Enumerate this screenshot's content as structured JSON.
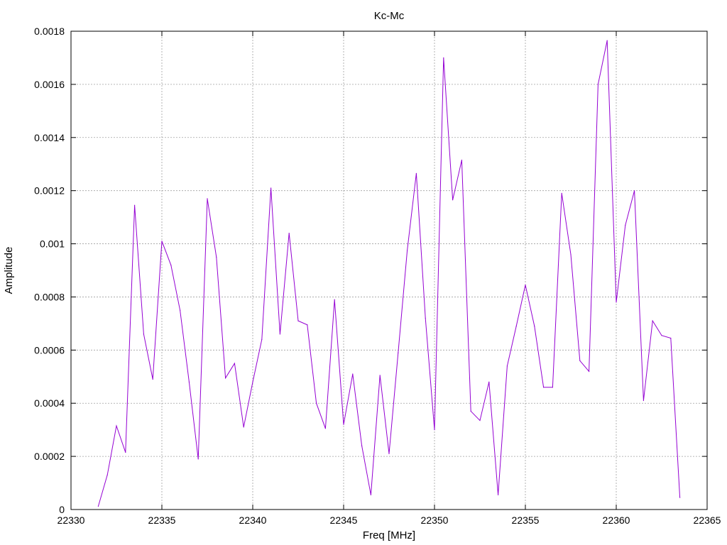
{
  "chart_data": {
    "type": "line",
    "title": "Kc-Mc",
    "xlabel": "Freq [MHz]",
    "ylabel": "Amplitude",
    "xlim": [
      22330,
      22365
    ],
    "ylim": [
      0,
      0.0018
    ],
    "x_ticks": [
      22330,
      22335,
      22340,
      22345,
      22350,
      22355,
      22360,
      22365
    ],
    "y_ticks": [
      0,
      0.0002,
      0.0004,
      0.0006,
      0.0008,
      0.001,
      0.0012,
      0.0014,
      0.0016,
      0.0018
    ],
    "x_tick_labels": [
      "22330",
      "22335",
      "22340",
      "22345",
      "22350",
      "22355",
      "22360",
      "22365"
    ],
    "y_tick_labels": [
      "0",
      "0.0002",
      "0.0004",
      "0.0006",
      "0.0008",
      "0.001",
      "0.0012",
      "0.0014",
      "0.0016",
      "0.0018"
    ],
    "grid": true,
    "series": [
      {
        "color": "#9400d3",
        "x": [
          22331.5,
          22332,
          22332.5,
          22333,
          22333.5,
          22334,
          22334.5,
          22335,
          22335.5,
          22336,
          22336.5,
          22337,
          22337.5,
          22338,
          22338.5,
          22339,
          22339.5,
          22340,
          22340.5,
          22341,
          22341.5,
          22342,
          22342.5,
          22343,
          22343.5,
          22344,
          22344.5,
          22345,
          22345.5,
          22346,
          22346.5,
          22347,
          22347.5,
          22348,
          22348.5,
          22349,
          22349.5,
          22350,
          22350.5,
          22351,
          22351.5,
          22352,
          22352.5,
          22353,
          22353.5,
          22354,
          22354.5,
          22355,
          22355.5,
          22356,
          22356.5,
          22357,
          22357.5,
          22358,
          22358.5,
          22359,
          22359.5,
          22360,
          22360.5,
          22361,
          22361.5,
          22362,
          22362.5,
          22363,
          22363.5
        ],
        "y": [
          1.2e-05,
          0.00013,
          0.000315,
          0.000215,
          0.001145,
          0.00066,
          0.00049,
          0.00101,
          0.00092,
          0.00075,
          0.00048,
          0.00019,
          0.00117,
          0.00095,
          0.000495,
          0.00055,
          0.00031,
          0.00048,
          0.00064,
          0.00121,
          0.00066,
          0.00104,
          0.00071,
          0.000695,
          0.0004,
          0.000305,
          0.00079,
          0.00032,
          0.00051,
          0.00024,
          5.5e-05,
          0.000505,
          0.00021,
          0.00059,
          0.000975,
          0.001265,
          0.00072,
          0.0003,
          0.0017,
          0.001165,
          0.001315,
          0.00037,
          0.000335,
          0.00048,
          5.5e-05,
          0.00054,
          0.00069,
          0.000845,
          0.00069,
          0.00046,
          0.00046,
          0.00119,
          0.00096,
          0.00056,
          0.00052,
          0.0016,
          0.001765,
          0.00078,
          0.00107,
          0.0012,
          0.00041,
          0.00071,
          0.000655,
          0.000645,
          4.5e-05
        ]
      }
    ]
  }
}
